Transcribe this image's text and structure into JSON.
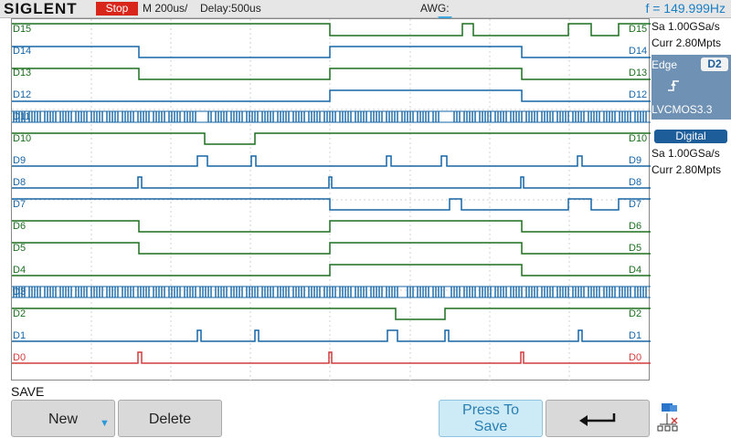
{
  "header": {
    "brand": "SIGLENT",
    "run_state": "Stop",
    "timebase": "M 200us/",
    "delay": "Delay:500us",
    "awg": "AWG:",
    "frequency": "f = 149.999Hz"
  },
  "channels": {
    "D15": "D15",
    "D14": "D14",
    "D13": "D13",
    "D12": "D12",
    "D11": "D11",
    "D10": "D10",
    "D9": "D9",
    "D8": "D8",
    "D7": "D7",
    "D6": "D6",
    "D5": "D5",
    "D4": "D4",
    "D3": "D3",
    "D2": "D2",
    "D1": "D1",
    "D0": "D0"
  },
  "right_panel": {
    "sample_rate_1": "Sa 1.00GSa/s",
    "curr_1": "Curr 2.80Mpts",
    "trigger_type": "Edge",
    "trigger_source": "D2",
    "trigger_level": "LVCMOS3.3",
    "digital_title": "Digital",
    "sample_rate_2": "Sa 1.00GSa/s",
    "curr_2": "Curr 2.80Mpts"
  },
  "menu": {
    "title": "SAVE",
    "new_label": "New",
    "delete_label": "Delete",
    "press_to_save_line1": "Press To",
    "press_to_save_line2": "Save"
  },
  "colors": {
    "green": "#1b6e1f",
    "blue": "#1565a6",
    "red": "#d23b3b",
    "accent": "#1d5d9a"
  },
  "icons": [
    "trigger-rising-edge-icon",
    "return-arrow-icon",
    "network-icon",
    "down-arrow-icon"
  ]
}
